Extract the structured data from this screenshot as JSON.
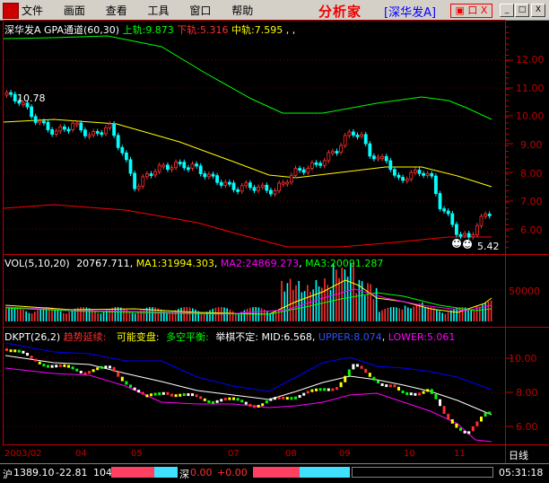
{
  "menubar": {
    "items": [
      "文件",
      "画面",
      "查看",
      "工具",
      "窗口",
      "帮助"
    ],
    "logo_text": "分析家",
    "stock_label": "[深华发A]",
    "red_button_text": "▣ 口 X",
    "win_buttons": [
      "_",
      "□",
      "X"
    ]
  },
  "main_panel": {
    "stock_name": "深华发A",
    "indicator": "GPA通道(60,30)",
    "upper_label": "上轨:",
    "upper_value": "9.873",
    "lower_label": "下轨:",
    "lower_value": "5.316",
    "mid_label": "中轨:",
    "mid_value": "7.595",
    "trailing": ",",
    "high_mark": "10.78",
    "low_mark": "5.42",
    "y_ticks": [
      "12.00",
      "11.00",
      "10.00",
      "9.00",
      "8.00",
      "7.00",
      "6.00"
    ]
  },
  "vol_panel": {
    "title": "VOL(5,10,20)",
    "value": "20767.711",
    "ma1_label": "MA1:",
    "ma1_value": "31994.303",
    "ma2_label": "MA2:",
    "ma2_value": "24869.273",
    "ma3_label": "MA3:",
    "ma3_value": "20091.287",
    "y_tick": "50000"
  },
  "dkpt_panel": {
    "title": "DKPT(26,2)",
    "trend": "趋势延续:",
    "change": "可能变盘:",
    "balance": "多空平衡:",
    "hesitate": "举棋不定:",
    "mid_label": "MID:",
    "mid_value": "6.568",
    "upper_label": "UPPER:",
    "upper_value": "8.074",
    "lower_label": "LOWER:",
    "lower_value": "5.061",
    "y_ticks": [
      "10.00",
      "8.00",
      "6.00"
    ]
  },
  "time_axis": {
    "labels": [
      "2003/02",
      "04",
      "05",
      "07",
      "08",
      "09",
      "10",
      "11"
    ],
    "period": "日线"
  },
  "statusbar": {
    "sh_label": "沪",
    "sh_index": "1389.10",
    "sh_change": "-22.81",
    "sh_volume": "104",
    "sz_label": "深",
    "sz_index": "0.00",
    "sz_change": "+0.00",
    "time": "05:31:18"
  },
  "colors": {
    "upper": "#00ff00",
    "lower": "#ff0000",
    "mid": "#ffff00",
    "up_candle": "#ff3030",
    "down_candle": "#00ffff",
    "ma1": "#ffff00",
    "ma2": "#ff00ff",
    "ma3": "#00ff00",
    "dk_upper": "#0000ff",
    "dk_lower": "#ff00ff",
    "dk_mid": "#ffffff"
  }
}
